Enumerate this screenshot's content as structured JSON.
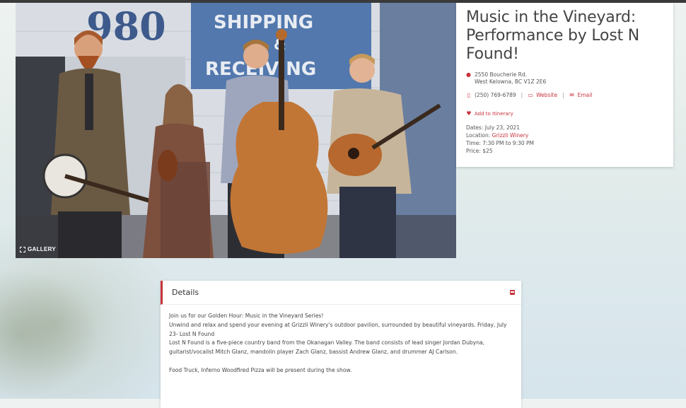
{
  "hero": {
    "gallery_label": "GALLERY",
    "sign_number": "980",
    "sign_line1": "SHIPPING",
    "sign_line2": "&",
    "sign_line3": "RECEIVING"
  },
  "event": {
    "title": "Music in the Vineyard: Performance by Lost N Found!",
    "address_line1": "2550 Boucherie Rd.",
    "address_line2": "West Kelowna, BC V1Z 2E6",
    "phone": "(250) 769-6789",
    "website_label": "Website",
    "email_label": "Email",
    "itinerary_label": "Add to Itinerary",
    "dates_label": "Dates:",
    "dates_value": "July 23, 2021",
    "location_label": "Location:",
    "location_value": "Grizzli Winery",
    "time_label": "Time:",
    "time_value": "7:30 PM to 9:30 PM",
    "price_label": "Price:",
    "price_value": "$25"
  },
  "details": {
    "heading": "Details",
    "paragraphs": [
      "Join us for our Golden Hour: Music in the Vineyard Series!",
      "Unwind and relax and spend your evening at Grizzli Winery's outdoor pavilion, surrounded by beautiful vineyards. Friday, July 23- Lost N Found",
      "Lost N Found is a five-piece country band from the Okanagan Valley. The band consists of lead singer Jordan Dubyna, guitarist/vocalist Mitch Glanz, mandolin player Zach Glanz, bassist Andrew Glanz, and drummer AJ Carlson.",
      "Food Truck, Inferno Woodfired Pizza will be present during the show."
    ]
  },
  "colors": {
    "accent": "#c8323c",
    "text": "#444444",
    "card_bg": "#ffffff"
  }
}
